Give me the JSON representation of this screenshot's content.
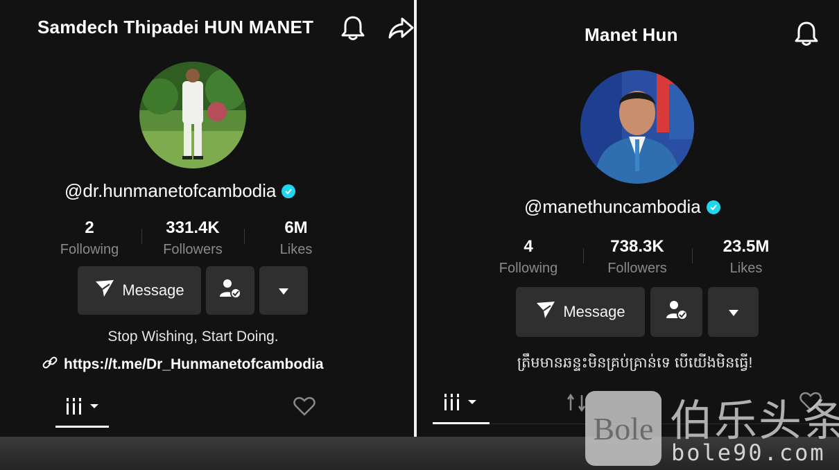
{
  "left_profile": {
    "title": "Samdech Thipadei HUN MANET",
    "handle": "@dr.hunmanetofcambodia",
    "stats": [
      {
        "value": "2",
        "label": "Following"
      },
      {
        "value": "331.4K",
        "label": "Followers"
      },
      {
        "value": "6M",
        "label": "Likes"
      }
    ],
    "message_label": "Message",
    "bio": "Stop Wishing, Start Doing.",
    "link": "https://t.me/Dr_Hunmanetofcambodia"
  },
  "right_profile": {
    "title": "Manet Hun",
    "handle": "@manethuncambodia",
    "stats": [
      {
        "value": "4",
        "label": "Following"
      },
      {
        "value": "738.3K",
        "label": "Followers"
      },
      {
        "value": "23.5M",
        "label": "Likes"
      }
    ],
    "message_label": "Message",
    "bio": "ត្រឹមមានឆន្ទះមិនគ្រប់គ្រាន់ទេ បើយើងមិនធ្វើ!"
  },
  "watermark": {
    "logo_text": "Bole",
    "cn_text": "伯乐头条",
    "url": "bole90.com"
  },
  "colors": {
    "background": "#121212",
    "verified": "#20d5ec",
    "button": "#2f2f2f",
    "secondary_text": "#8a8a8a"
  }
}
